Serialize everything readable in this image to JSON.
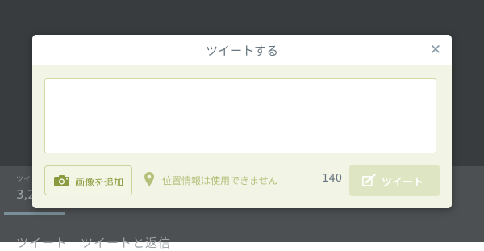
{
  "background": {
    "stat_label": "ツイ",
    "stat_value": "3,2",
    "tabs_text": "ツイート　ツイートと返信"
  },
  "modal": {
    "title": "ツイートする",
    "close_icon": "close-icon",
    "tweet_text": "",
    "photo_button_label": "画像を追加",
    "photo_icon": "camera-icon",
    "location_label": "位置情報は使用できません",
    "location_icon": "map-pin-icon",
    "char_count": "140",
    "tweet_button_label": "ツイート",
    "tweet_button_icon": "compose-icon",
    "tweet_button_disabled": true
  },
  "colors": {
    "accent": "#8a9a3e",
    "disabled_button": "#dee5c2",
    "backdrop": "#393c3e"
  }
}
